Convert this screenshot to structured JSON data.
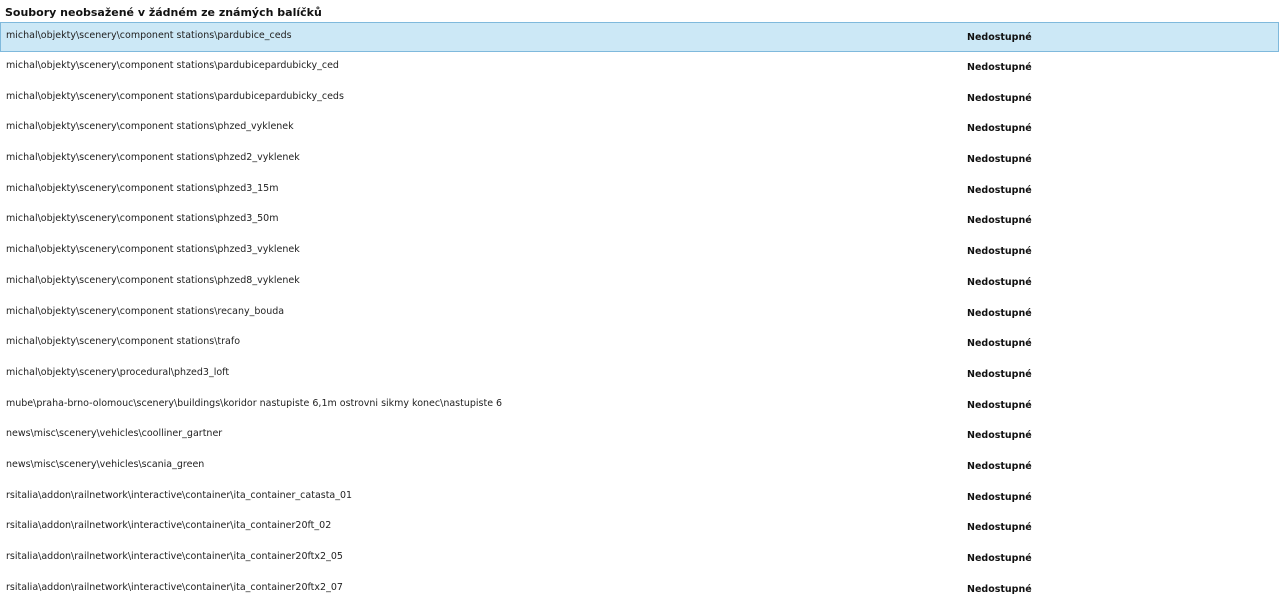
{
  "heading": "Soubory neobsažené v žádném ze známých balíčků",
  "colors": {
    "selected_background": "#cce8f6",
    "selected_border": "#7fb9dc"
  },
  "selected_index": 0,
  "rows": [
    {
      "path": "michal\\objekty\\scenery\\component stations\\pardubice_ceds",
      "status": "Nedostupné"
    },
    {
      "path": "michal\\objekty\\scenery\\component stations\\pardubicepardubicky_ced",
      "status": "Nedostupné"
    },
    {
      "path": "michal\\objekty\\scenery\\component stations\\pardubicepardubicky_ceds",
      "status": "Nedostupné"
    },
    {
      "path": "michal\\objekty\\scenery\\component stations\\phzed_vyklenek",
      "status": "Nedostupné"
    },
    {
      "path": "michal\\objekty\\scenery\\component stations\\phzed2_vyklenek",
      "status": "Nedostupné"
    },
    {
      "path": "michal\\objekty\\scenery\\component stations\\phzed3_15m",
      "status": "Nedostupné"
    },
    {
      "path": "michal\\objekty\\scenery\\component stations\\phzed3_50m",
      "status": "Nedostupné"
    },
    {
      "path": "michal\\objekty\\scenery\\component stations\\phzed3_vyklenek",
      "status": "Nedostupné"
    },
    {
      "path": "michal\\objekty\\scenery\\component stations\\phzed8_vyklenek",
      "status": "Nedostupné"
    },
    {
      "path": "michal\\objekty\\scenery\\component stations\\recany_bouda",
      "status": "Nedostupné"
    },
    {
      "path": "michal\\objekty\\scenery\\component stations\\trafo",
      "status": "Nedostupné"
    },
    {
      "path": "michal\\objekty\\scenery\\procedural\\phzed3_loft",
      "status": "Nedostupné"
    },
    {
      "path": "mube\\praha-brno-olomouc\\scenery\\buildings\\koridor nastupiste 6,1m ostrovni sikmy konec\\nastupiste 6",
      "status": "Nedostupné"
    },
    {
      "path": "news\\misc\\scenery\\vehicles\\coolliner_gartner",
      "status": "Nedostupné"
    },
    {
      "path": "news\\misc\\scenery\\vehicles\\scania_green",
      "status": "Nedostupné"
    },
    {
      "path": "rsitalia\\addon\\railnetwork\\interactive\\container\\ita_container_catasta_01",
      "status": "Nedostupné"
    },
    {
      "path": "rsitalia\\addon\\railnetwork\\interactive\\container\\ita_container20ft_02",
      "status": "Nedostupné"
    },
    {
      "path": "rsitalia\\addon\\railnetwork\\interactive\\container\\ita_container20ftx2_05",
      "status": "Nedostupné"
    },
    {
      "path": "rsitalia\\addon\\railnetwork\\interactive\\container\\ita_container20ftx2_07",
      "status": "Nedostupné"
    }
  ]
}
